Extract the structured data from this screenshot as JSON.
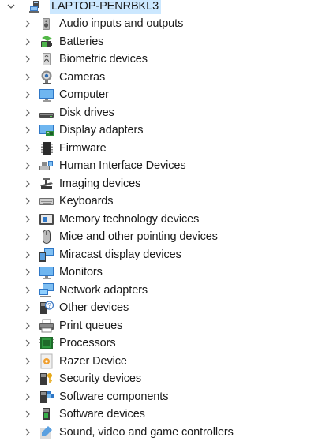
{
  "root": {
    "label": "LAPTOP-PENRBKL3",
    "icon": "computer-icon",
    "expanded": true
  },
  "items": [
    {
      "label": "Audio inputs and outputs",
      "icon": "speaker-icon"
    },
    {
      "label": "Batteries",
      "icon": "battery-icon"
    },
    {
      "label": "Biometric devices",
      "icon": "fingerprint-icon"
    },
    {
      "label": "Cameras",
      "icon": "camera-icon"
    },
    {
      "label": "Computer",
      "icon": "monitor-icon"
    },
    {
      "label": "Disk drives",
      "icon": "disk-drive-icon"
    },
    {
      "label": "Display adapters",
      "icon": "display-adapter-icon"
    },
    {
      "label": "Firmware",
      "icon": "firmware-chip-icon"
    },
    {
      "label": "Human Interface Devices",
      "icon": "hid-icon"
    },
    {
      "label": "Imaging devices",
      "icon": "scanner-icon"
    },
    {
      "label": "Keyboards",
      "icon": "keyboard-icon"
    },
    {
      "label": "Memory technology devices",
      "icon": "memory-card-icon"
    },
    {
      "label": "Mice and other pointing devices",
      "icon": "mouse-icon"
    },
    {
      "label": "Miracast display devices",
      "icon": "miracast-icon"
    },
    {
      "label": "Monitors",
      "icon": "monitor-icon"
    },
    {
      "label": "Network adapters",
      "icon": "network-icon"
    },
    {
      "label": "Other devices",
      "icon": "unknown-device-icon"
    },
    {
      "label": "Print queues",
      "icon": "printer-icon"
    },
    {
      "label": "Processors",
      "icon": "processor-icon"
    },
    {
      "label": "Razer Device",
      "icon": "razer-device-icon"
    },
    {
      "label": "Security devices",
      "icon": "security-key-icon"
    },
    {
      "label": "Software components",
      "icon": "software-component-icon"
    },
    {
      "label": "Software devices",
      "icon": "software-device-icon"
    },
    {
      "label": "Sound, video and game controllers",
      "icon": "sound-controller-icon"
    }
  ]
}
